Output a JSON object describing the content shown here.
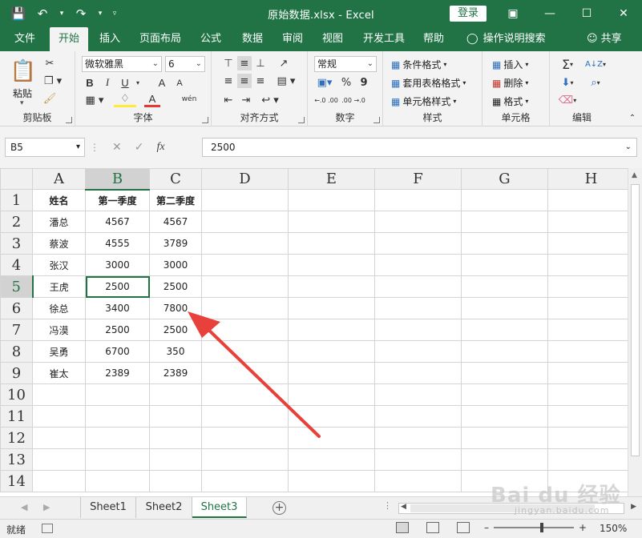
{
  "window": {
    "title": "原始数据.xlsx  -  Excel",
    "login": "登录"
  },
  "tabs": [
    "文件",
    "开始",
    "插入",
    "页面布局",
    "公式",
    "数据",
    "审阅",
    "视图",
    "开发工具",
    "帮助"
  ],
  "active_tab": "开始",
  "tellme": "操作说明搜索",
  "share": "共享",
  "ribbon": {
    "clipboard": {
      "label": "剪贴板",
      "paste": "粘贴"
    },
    "font": {
      "label": "字体",
      "name": "微软雅黑",
      "size": "6",
      "bold": "B",
      "italic": "I",
      "underline": "U",
      "grow": "A",
      "shrink": "A",
      "fontcolor": "A",
      "phonetic": "wén"
    },
    "alignment": {
      "label": "对齐方式"
    },
    "number": {
      "label": "数字",
      "format": "常规",
      "percent": "%",
      "comma": "9",
      "inc": "←.0 .00",
      "dec": ".00 →.0"
    },
    "styles": {
      "label": "样式",
      "conditional": "条件格式",
      "table": "套用表格格式",
      "cell": "单元格样式"
    },
    "cells": {
      "label": "单元格",
      "insert": "插入",
      "delete": "删除",
      "format": "格式"
    },
    "editing": {
      "label": "编辑",
      "sum": "Σ",
      "sort": "A↓Z",
      "find": "⌕"
    }
  },
  "formula_bar": {
    "namebox": "B5",
    "fx": "fx",
    "value": "2500"
  },
  "columns": [
    "A",
    "B",
    "C",
    "D",
    "E",
    "F",
    "G",
    "H"
  ],
  "rows": [
    [
      "姓名",
      "第一季度",
      "第二季度",
      "",
      "",
      "",
      "",
      ""
    ],
    [
      "潘总",
      "4567",
      "4567",
      "",
      "",
      "",
      "",
      ""
    ],
    [
      "蔡波",
      "4555",
      "3789",
      "",
      "",
      "",
      "",
      ""
    ],
    [
      "张汉",
      "3000",
      "3000",
      "",
      "",
      "",
      "",
      ""
    ],
    [
      "王虎",
      "2500",
      "2500",
      "",
      "",
      "",
      "",
      ""
    ],
    [
      "徐总",
      "3400",
      "7800",
      "",
      "",
      "",
      "",
      ""
    ],
    [
      "冯漠",
      "2500",
      "2500",
      "",
      "",
      "",
      "",
      ""
    ],
    [
      "吴勇",
      "6700",
      "350",
      "",
      "",
      "",
      "",
      ""
    ],
    [
      "崔太",
      "2389",
      "2389",
      "",
      "",
      "",
      "",
      ""
    ],
    [
      "",
      "",
      "",
      "",
      "",
      "",
      "",
      ""
    ],
    [
      "",
      "",
      "",
      "",
      "",
      "",
      "",
      ""
    ],
    [
      "",
      "",
      "",
      "",
      "",
      "",
      "",
      ""
    ],
    [
      "",
      "",
      "",
      "",
      "",
      "",
      "",
      ""
    ],
    [
      "",
      "",
      "",
      "",
      "",
      "",
      "",
      ""
    ]
  ],
  "row_numbers": [
    "1",
    "2",
    "3",
    "4",
    "5",
    "6",
    "7",
    "8",
    "9",
    "10",
    "11",
    "12",
    "13",
    "14"
  ],
  "sheets": [
    "Sheet1",
    "Sheet2",
    "Sheet3"
  ],
  "active_sheet": "Sheet3",
  "status": {
    "ready": "就绪",
    "zoom": "150%"
  },
  "watermark": {
    "brand": "Bai du 经验",
    "url": "jingyan.baidu.com"
  },
  "colors": {
    "accent": "#217346",
    "arrow": "#e8403a"
  }
}
